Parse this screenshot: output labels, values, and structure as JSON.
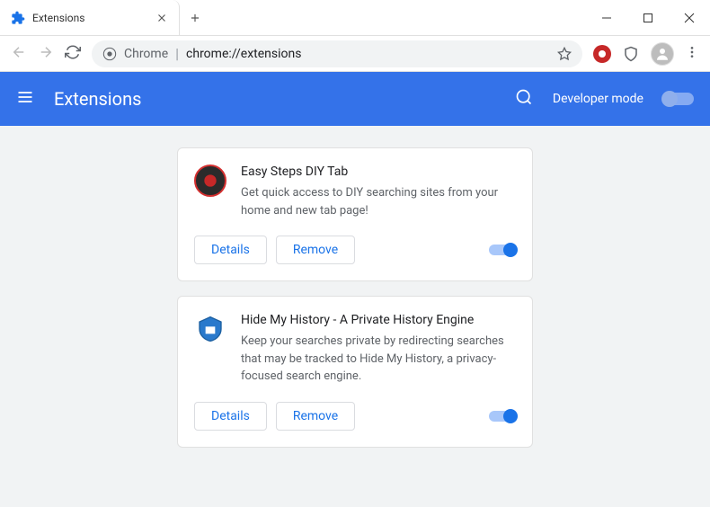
{
  "window": {
    "tab_title": "Extensions"
  },
  "omnibox": {
    "scheme": "Chrome",
    "path": "chrome://extensions"
  },
  "header": {
    "title": "Extensions",
    "dev_mode_label": "Developer mode"
  },
  "buttons": {
    "details": "Details",
    "remove": "Remove"
  },
  "extensions": [
    {
      "title": "Easy Steps DIY Tab",
      "description": "Get quick access to DIY searching sites from your home and new tab page!",
      "icon": "diy",
      "enabled": true
    },
    {
      "title": "Hide My History - A Private History Engine",
      "description": "Keep your searches private by redirecting searches that may be tracked to Hide My History, a privacy-focused search engine.",
      "icon": "shield",
      "enabled": true
    }
  ]
}
